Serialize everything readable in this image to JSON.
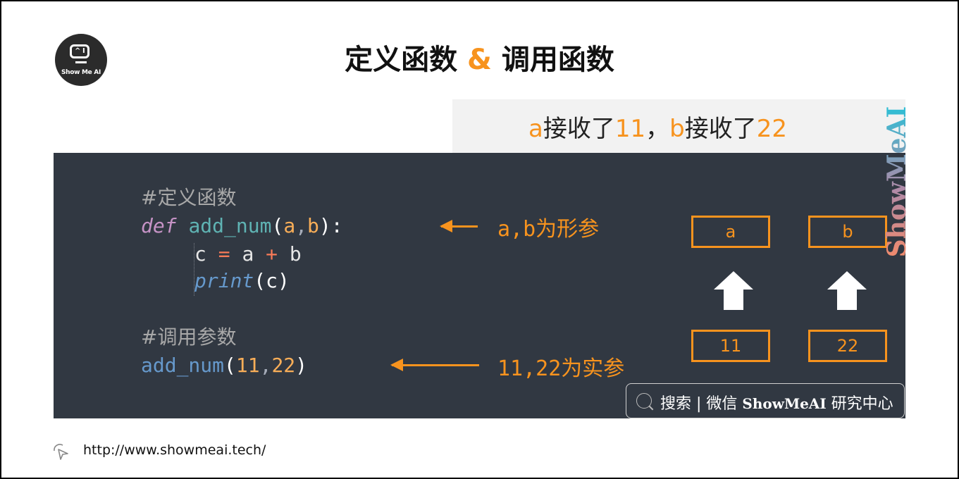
{
  "brand": {
    "logo_text": "Show Me AI",
    "logo_screen_glyph": "^ I",
    "watermark": "ShowMeAI"
  },
  "title": {
    "left": "定义函数",
    "amp": "&",
    "right": "调用函数"
  },
  "callout": {
    "a": "a",
    "recv1": "接收了",
    "v1": "11",
    "sep": "，",
    "b": "b",
    "recv2": "接收了",
    "v2": "22"
  },
  "code": {
    "comment_def": "#定义函数",
    "def_kw": "def",
    "fn_name": "add_num",
    "paren_open": "(",
    "param_a": "a",
    "comma": ",",
    "param_b": "b",
    "paren_close_colon": "):",
    "body1_c": "c",
    "body1_eq": "=",
    "body1_a": "a",
    "body1_plus": "+",
    "body1_b": "b",
    "print_fn": "print",
    "print_args": "(c)",
    "comment_call": "#调用参数",
    "call_fn": "add_num",
    "call_arg1": "11",
    "call_arg2": "22",
    "call_close": ")"
  },
  "annotations": {
    "formal": "a,b为形参",
    "actual": "11,22为实参"
  },
  "diagram": {
    "params": [
      "a",
      "b"
    ],
    "args": [
      "11",
      "22"
    ]
  },
  "search_badge": {
    "prefix": "搜索 | 微信 ",
    "brand": "ShowMeAI",
    "suffix": " 研究中心"
  },
  "footer": {
    "url": "http://www.showmeai.tech/"
  },
  "colors": {
    "accent": "#f7931e",
    "code_bg": "#313842",
    "callout_bg": "#f2f2f2"
  }
}
